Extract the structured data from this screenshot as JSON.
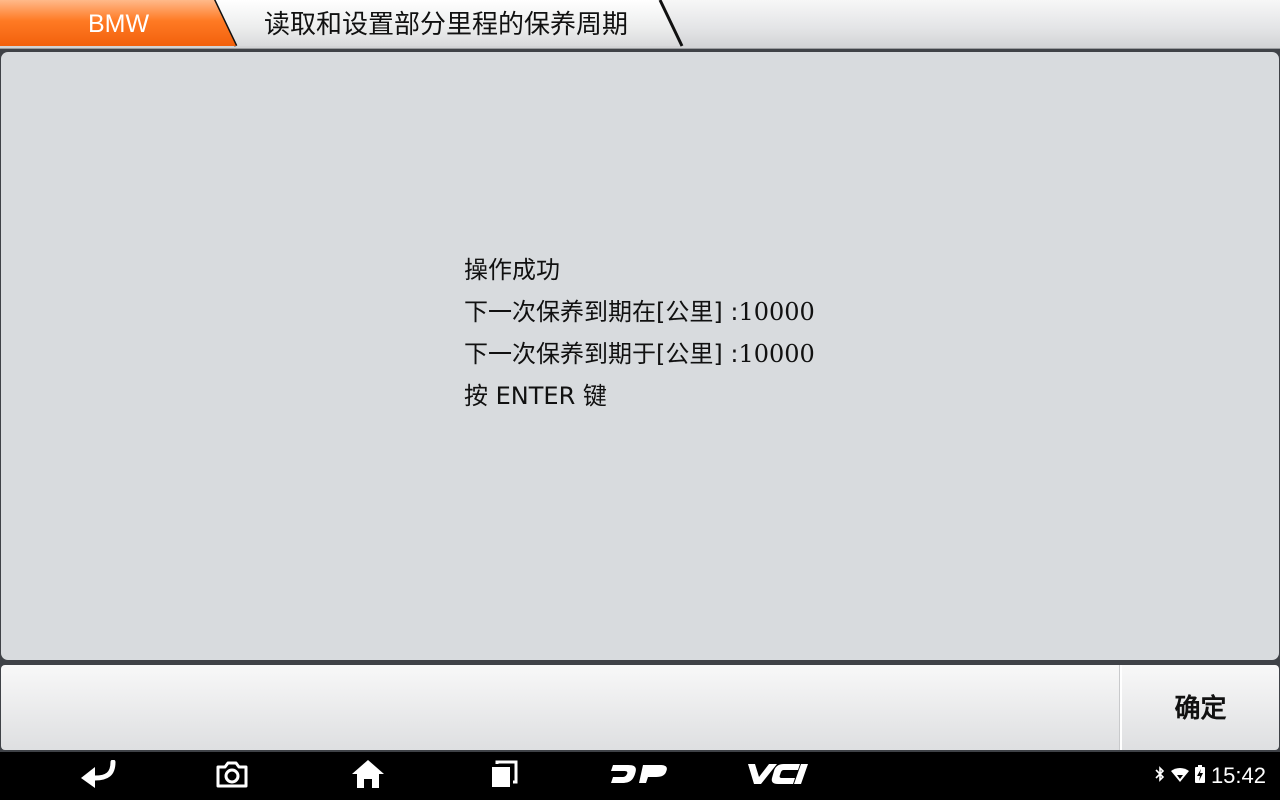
{
  "header": {
    "brand": "BMW",
    "title": "读取和设置部分里程的保养周期"
  },
  "message": {
    "lines": [
      "操作成功",
      "下一次保养到期在[公里] :",
      "下一次保养到期于[公里] :",
      "按 ENTER 键"
    ],
    "values": [
      "10000",
      "10000"
    ]
  },
  "actions": {
    "confirm_label": "确定"
  },
  "nav": {
    "items": [
      {
        "icon": "back-icon"
      },
      {
        "icon": "screenshot-icon"
      },
      {
        "icon": "home-icon"
      },
      {
        "icon": "recent-apps-icon"
      },
      {
        "icon": "dp-icon"
      },
      {
        "icon": "vci-icon"
      }
    ],
    "dp_label": "DP",
    "vci_label": "VCI"
  },
  "status": {
    "time": "15:42",
    "icons": [
      "bluetooth-icon",
      "wifi-icon",
      "battery-icon"
    ]
  },
  "colors": {
    "brand_tab": "#ff6a13",
    "content_bg": "#d8dbde",
    "nav_bg": "#000000"
  }
}
